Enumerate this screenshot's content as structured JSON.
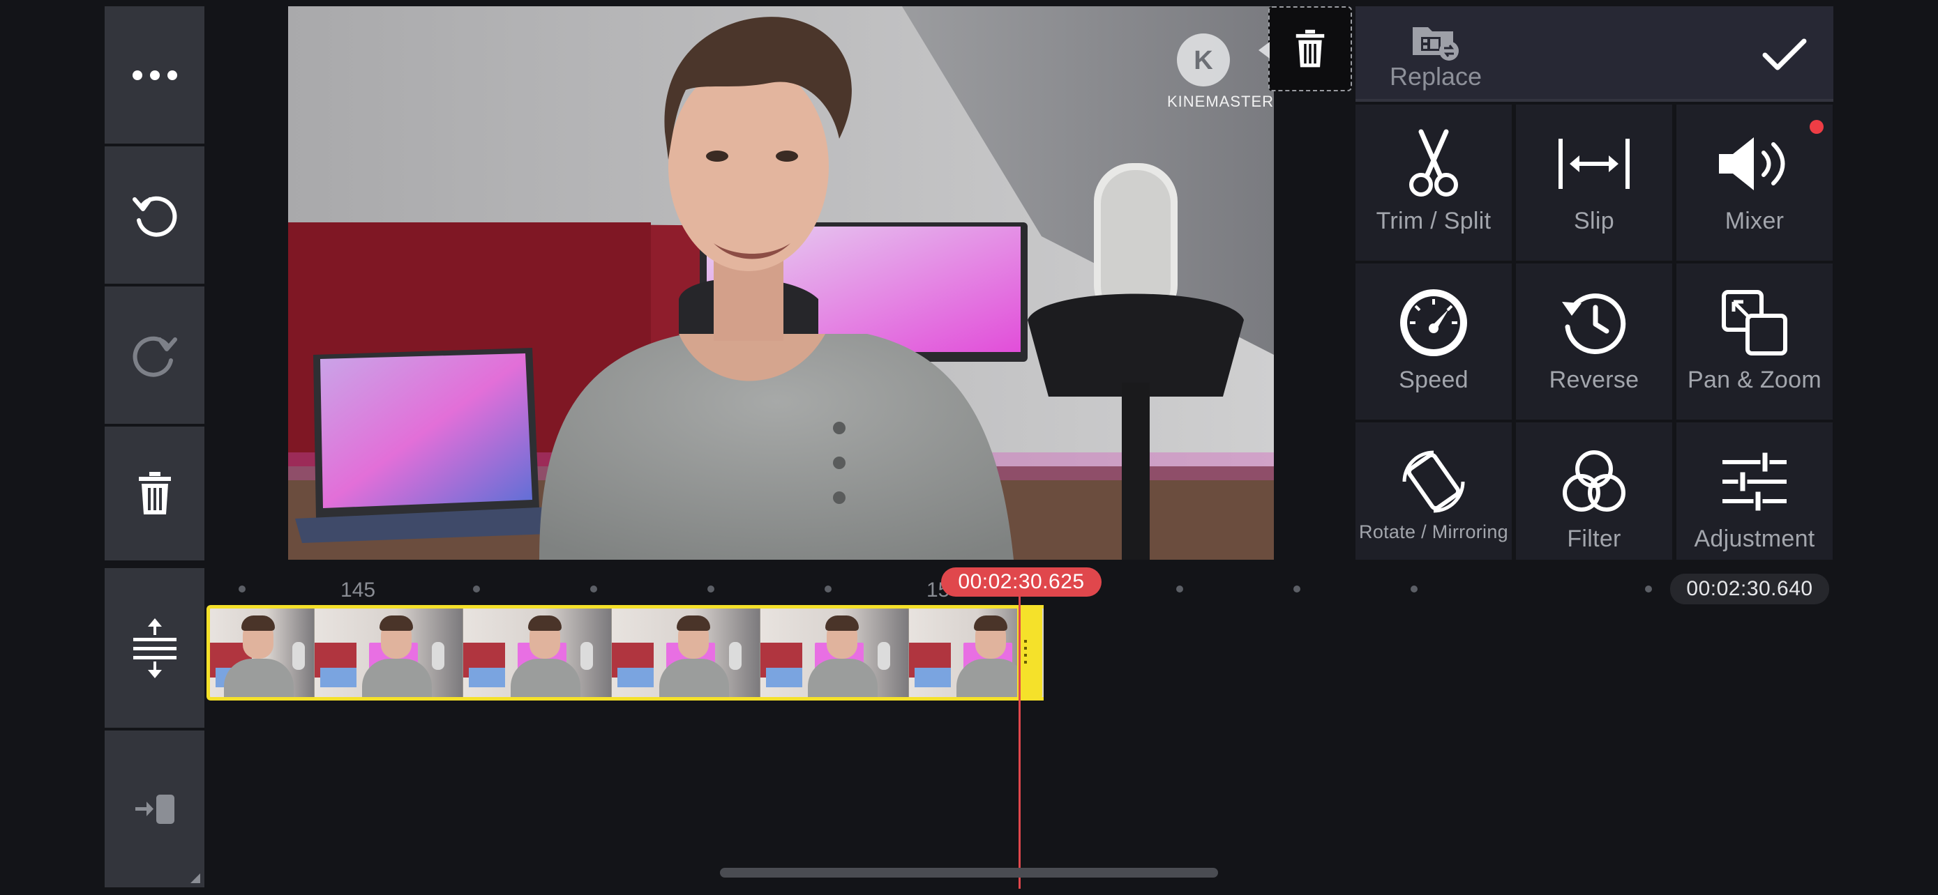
{
  "left_toolbar": {
    "more_icon": "more-horizontal-icon",
    "undo_icon": "undo-icon",
    "redo_icon": "redo-icon",
    "delete_icon": "trash-icon"
  },
  "preview": {
    "watermark": "KINEMASTER",
    "watermark_letter": "K"
  },
  "panel": {
    "replace_label": "Replace",
    "items": [
      {
        "label": "Trim / Split",
        "icon": "scissors-icon"
      },
      {
        "label": "Slip",
        "icon": "slip-icon"
      },
      {
        "label": "Mixer",
        "icon": "speaker-icon"
      },
      {
        "label": "Speed",
        "icon": "speedometer-icon"
      },
      {
        "label": "Reverse",
        "icon": "reverse-clock-icon"
      },
      {
        "label": "Pan & Zoom",
        "icon": "pan-zoom-icon"
      },
      {
        "label": "Rotate / Mirroring",
        "icon": "rotate-icon"
      },
      {
        "label": "Filter",
        "icon": "filter-icon"
      },
      {
        "label": "Adjustment",
        "icon": "sliders-icon"
      }
    ]
  },
  "timeline": {
    "ruler_label_1": "145",
    "ruler_label_2": "15",
    "playhead_time": "00:02:30.625",
    "total_time": "00:02:30.640",
    "colors": {
      "playhead": "#e0474c",
      "clip_border": "#f5e12a"
    }
  }
}
